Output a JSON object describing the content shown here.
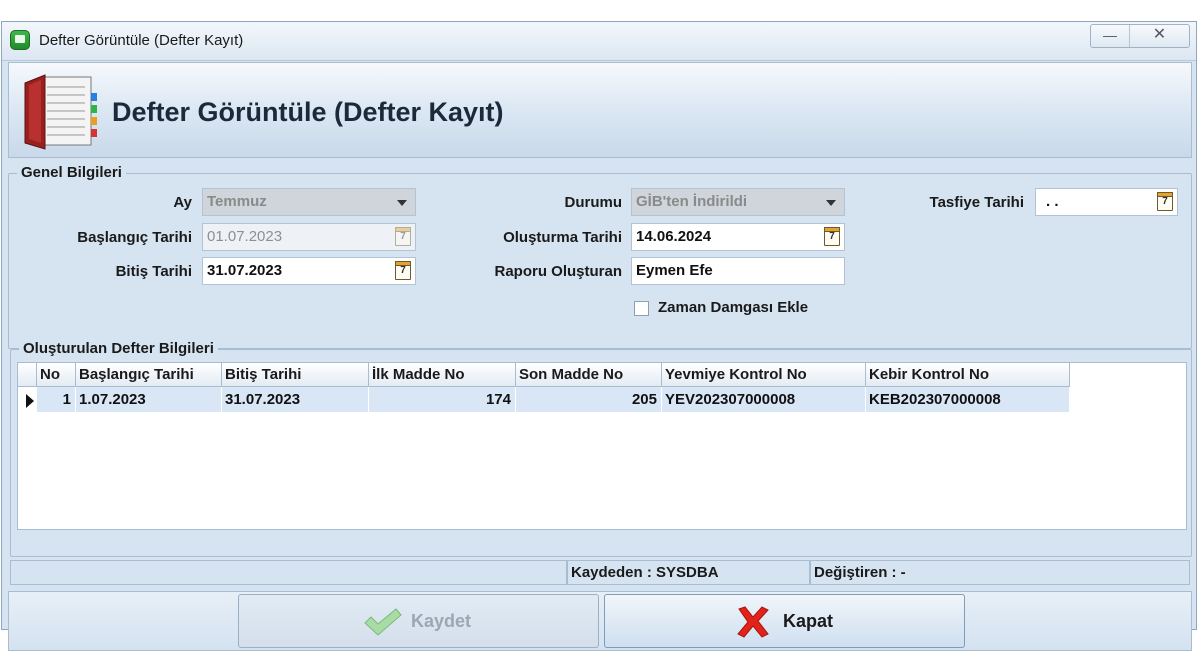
{
  "window": {
    "title": "Defter Görüntüle (Defter Kayıt)",
    "min_glyph": "—",
    "close_glyph": "✕"
  },
  "header": {
    "title": "Defter Görüntüle (Defter Kayıt)"
  },
  "general": {
    "legend": "Genel Bilgileri",
    "ay_label": "Ay",
    "ay_value": "Temmuz",
    "baslangic_label": "Başlangıç Tarihi",
    "baslangic_value": "01.07.2023",
    "bitis_label": "Bitiş Tarihi",
    "bitis_value": "31.07.2023",
    "durumu_label": "Durumu",
    "durumu_value": "GİB'ten İndirildi",
    "olusturma_label": "Oluşturma Tarihi",
    "olusturma_value": "14.06.2024",
    "raporu_label": "Raporu Oluşturan",
    "raporu_value": "Eymen  Efe",
    "tasfiye_label": "Tasfiye Tarihi",
    "tasfiye_value": ". .",
    "zaman_label": "Zaman Damgası Ekle",
    "calendar_day": "7"
  },
  "books": {
    "legend": "Oluşturulan Defter Bilgileri",
    "columns": [
      "No",
      "Başlangıç Tarihi",
      "Bitiş Tarihi",
      "İlk Madde No",
      "Son Madde No",
      "Yevmiye Kontrol No",
      "Kebir Kontrol No"
    ],
    "rows": [
      [
        "1",
        "1.07.2023",
        "31.07.2023",
        "174",
        "205",
        "YEV202307000008",
        "KEB202307000008"
      ]
    ]
  },
  "status": {
    "kaydeden": "Kaydeden : SYSDBA",
    "degistiren": "Değiştiren :  -"
  },
  "buttons": {
    "save": "Kaydet",
    "close": "Kapat"
  },
  "colors": {
    "accent": "#d6e4f1",
    "selected_row": "#d8e6f6",
    "close_icon": "#e2231a",
    "save_icon": "#8fd48a"
  }
}
